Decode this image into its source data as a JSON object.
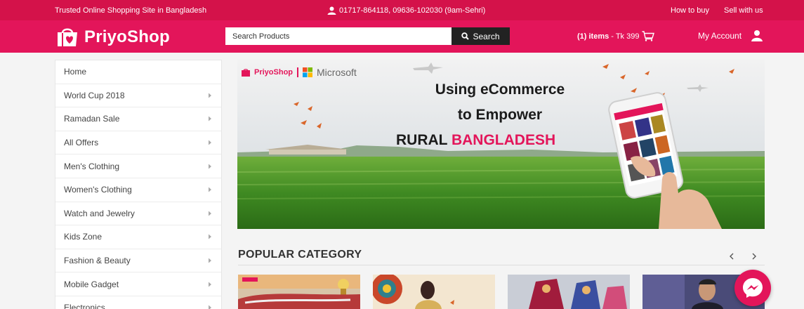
{
  "topbar": {
    "tagline": "Trusted Online Shopping Site in Bangladesh",
    "phone": "01717-864118, 09636-102030 (9am-Sehri)",
    "how_to_buy": "How to buy",
    "sell_with_us": "Sell with us"
  },
  "header": {
    "logo_text": "PriyoShop",
    "search_placeholder": "Search Products",
    "search_button": "Search",
    "cart_count": "(1) items",
    "cart_total": " - Tk 399",
    "account_label": "My Account"
  },
  "sidebar": {
    "items": [
      {
        "label": "Home",
        "has_arrow": false
      },
      {
        "label": "World Cup 2018",
        "has_arrow": true
      },
      {
        "label": "Ramadan Sale",
        "has_arrow": true
      },
      {
        "label": "All Offers",
        "has_arrow": true
      },
      {
        "label": "Men's Clothing",
        "has_arrow": true
      },
      {
        "label": "Women's Clothing",
        "has_arrow": true
      },
      {
        "label": "Watch and Jewelry",
        "has_arrow": true
      },
      {
        "label": "Kids Zone",
        "has_arrow": true
      },
      {
        "label": "Fashion & Beauty",
        "has_arrow": true
      },
      {
        "label": "Mobile Gadget",
        "has_arrow": true
      },
      {
        "label": "Electronics",
        "has_arrow": true
      }
    ]
  },
  "banner": {
    "brand1": "PriyoShop",
    "brand2": "Microsoft",
    "line1": "Using eCommerce",
    "line2": "to Empower",
    "line3a": "RURAL",
    "line3b": "BANGLADESH"
  },
  "popular": {
    "title": "POPULAR CATEGORY",
    "prev": "‹",
    "next": "›"
  },
  "colors": {
    "brand": "#e3155a",
    "topbar": "#d4124a",
    "dark": "#222222",
    "bangladesh_red": "#e3155a",
    "bangladesh_green": "#1d8c3a"
  }
}
